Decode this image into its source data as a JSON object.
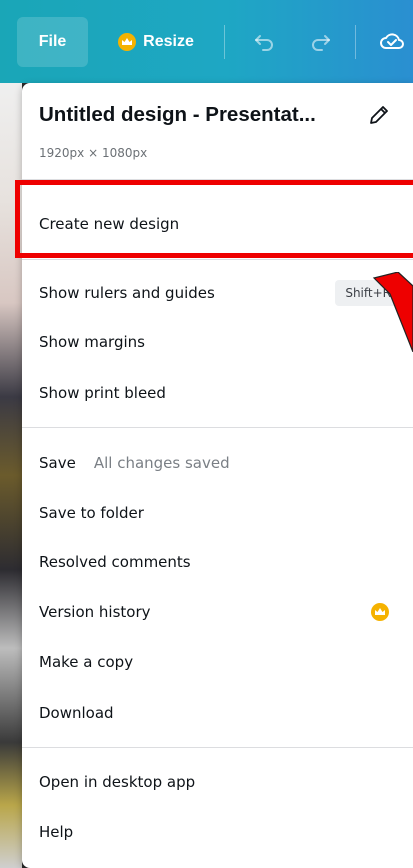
{
  "toolbar": {
    "file_label": "File",
    "resize_label": "Resize"
  },
  "menu": {
    "title": "Untitled design - Presentat...",
    "size": "1920px × 1080px",
    "create_new": "Create new design",
    "rulers": "Show rulers and guides",
    "rulers_shortcut": "Shift+R",
    "margins": "Show margins",
    "print_bleed": "Show print bleed",
    "save": "Save",
    "save_status": "All changes saved",
    "save_to_folder": "Save to folder",
    "resolved_comments": "Resolved comments",
    "version_history": "Version history",
    "make_copy": "Make a copy",
    "download": "Download",
    "open_desktop": "Open in desktop app",
    "help": "Help"
  },
  "colors": {
    "toolbar_gradient_start": "#1aa6b7",
    "toolbar_gradient_end": "#2a8fd1",
    "crown": "#f5b200",
    "annotation": "#ee0000"
  },
  "icons": [
    "crown-icon",
    "undo-icon",
    "redo-icon",
    "cloud-check-icon",
    "pencil-icon"
  ]
}
